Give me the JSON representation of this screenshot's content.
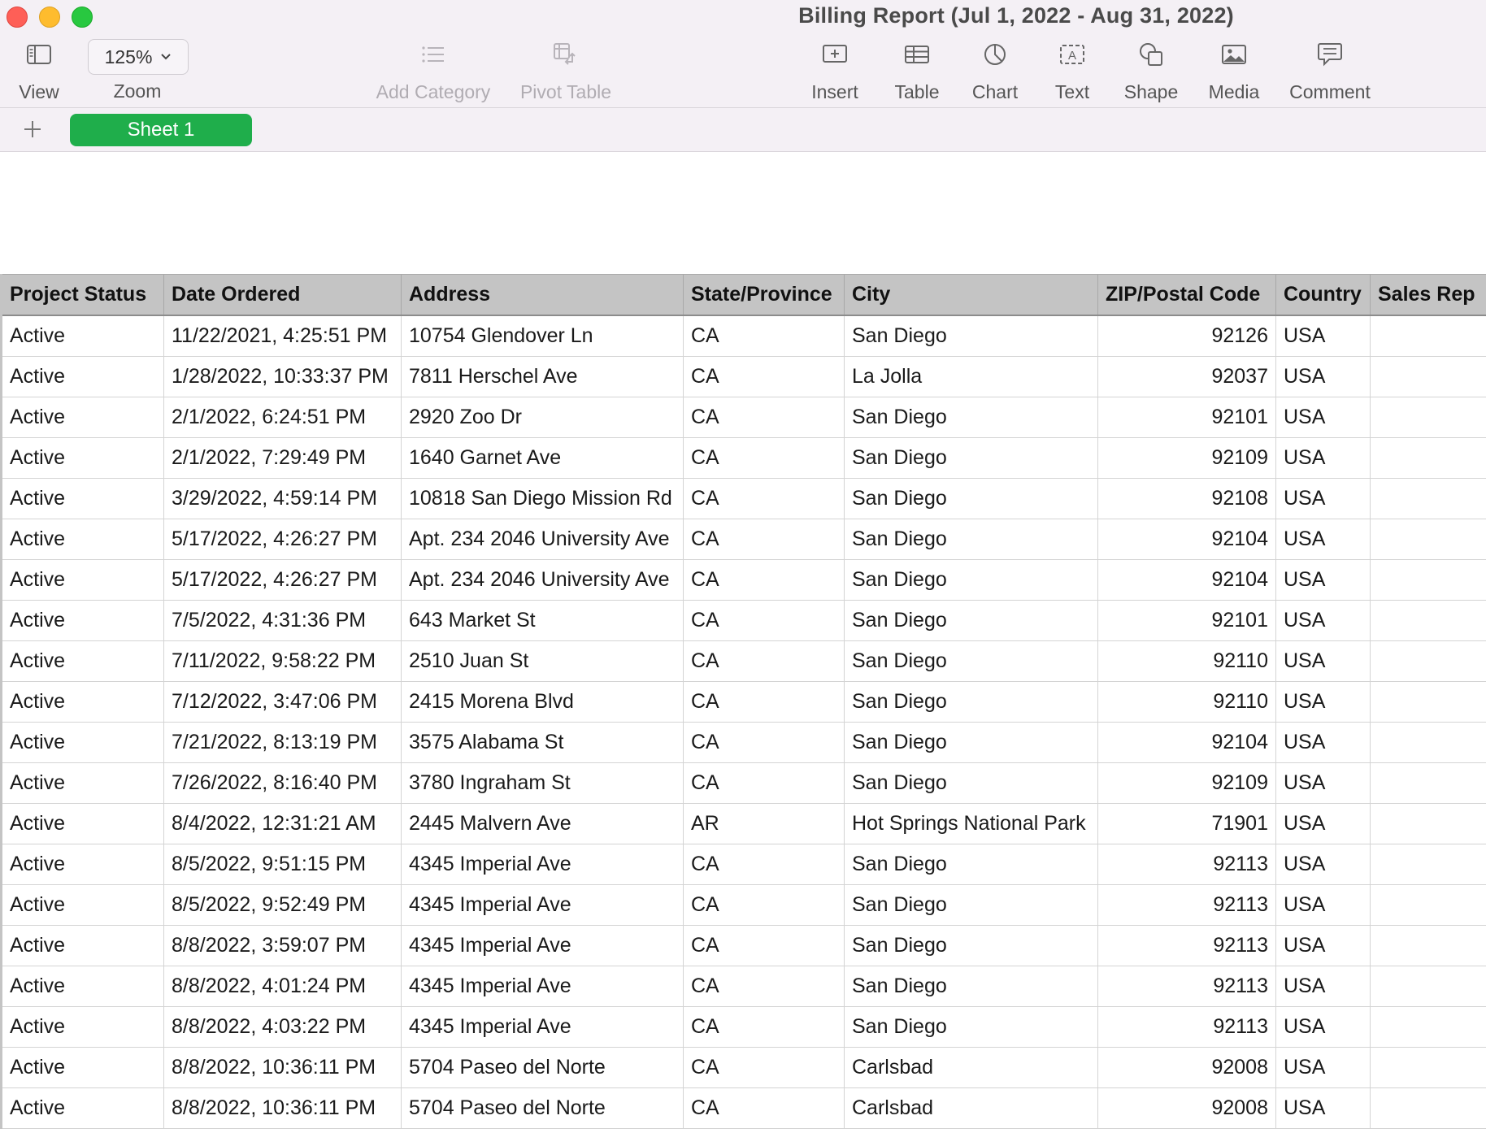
{
  "window": {
    "title": "Billing Report (Jul 1, 2022 - Aug 31, 2022)"
  },
  "toolbar": {
    "view_label": "View",
    "zoom_value": "125%",
    "zoom_label": "Zoom",
    "add_category_label": "Add Category",
    "pivot_table_label": "Pivot Table",
    "insert_label": "Insert",
    "table_label": "Table",
    "chart_label": "Chart",
    "text_label": "Text",
    "shape_label": "Shape",
    "media_label": "Media",
    "comment_label": "Comment"
  },
  "sheets": {
    "active_tab": "Sheet 1"
  },
  "colors": {
    "sheet_tab": "#1fae4b",
    "header_bg": "#c4c4c4",
    "toolbar_bg": "#f4f0f5"
  },
  "table": {
    "headers": [
      "Project Status",
      "Date Ordered",
      "Address",
      "State/Province",
      "City",
      "ZIP/Postal Code",
      "Country",
      "Sales Rep"
    ],
    "rows": [
      [
        "Active",
        "11/22/2021, 4:25:51 PM",
        "10754 Glendover Ln",
        "CA",
        "San Diego",
        "92126",
        "USA",
        ""
      ],
      [
        "Active",
        "1/28/2022, 10:33:37 PM",
        "7811 Herschel Ave",
        "CA",
        "La Jolla",
        "92037",
        "USA",
        ""
      ],
      [
        "Active",
        "2/1/2022, 6:24:51 PM",
        "2920 Zoo Dr",
        "CA",
        "San Diego",
        "92101",
        "USA",
        ""
      ],
      [
        "Active",
        "2/1/2022, 7:29:49 PM",
        "1640 Garnet Ave",
        "CA",
        "San Diego",
        "92109",
        "USA",
        ""
      ],
      [
        "Active",
        "3/29/2022, 4:59:14 PM",
        "10818 San Diego Mission Rd",
        "CA",
        "San Diego",
        "92108",
        "USA",
        ""
      ],
      [
        "Active",
        "5/17/2022, 4:26:27 PM",
        "Apt. 234 2046 University Ave",
        "CA",
        "San Diego",
        "92104",
        "USA",
        ""
      ],
      [
        "Active",
        "5/17/2022, 4:26:27 PM",
        "Apt. 234 2046 University Ave",
        "CA",
        "San Diego",
        "92104",
        "USA",
        ""
      ],
      [
        "Active",
        "7/5/2022, 4:31:36 PM",
        "643 Market St",
        "CA",
        "San Diego",
        "92101",
        "USA",
        ""
      ],
      [
        "Active",
        "7/11/2022, 9:58:22 PM",
        "2510 Juan St",
        "CA",
        "San Diego",
        "92110",
        "USA",
        ""
      ],
      [
        "Active",
        "7/12/2022, 3:47:06 PM",
        "2415 Morena Blvd",
        "CA",
        "San Diego",
        "92110",
        "USA",
        ""
      ],
      [
        "Active",
        "7/21/2022, 8:13:19 PM",
        "3575 Alabama St",
        "CA",
        "San Diego",
        "92104",
        "USA",
        ""
      ],
      [
        "Active",
        "7/26/2022, 8:16:40 PM",
        "3780 Ingraham St",
        "CA",
        "San Diego",
        "92109",
        "USA",
        ""
      ],
      [
        "Active",
        "8/4/2022, 12:31:21 AM",
        "2445 Malvern Ave",
        "AR",
        "Hot Springs National Park",
        "71901",
        "USA",
        ""
      ],
      [
        "Active",
        "8/5/2022, 9:51:15 PM",
        "4345 Imperial Ave",
        "CA",
        "San Diego",
        "92113",
        "USA",
        ""
      ],
      [
        "Active",
        "8/5/2022, 9:52:49 PM",
        "4345 Imperial Ave",
        "CA",
        "San Diego",
        "92113",
        "USA",
        ""
      ],
      [
        "Active",
        "8/8/2022, 3:59:07 PM",
        "4345 Imperial Ave",
        "CA",
        "San Diego",
        "92113",
        "USA",
        ""
      ],
      [
        "Active",
        "8/8/2022, 4:01:24 PM",
        "4345 Imperial Ave",
        "CA",
        "San Diego",
        "92113",
        "USA",
        ""
      ],
      [
        "Active",
        "8/8/2022, 4:03:22 PM",
        "4345 Imperial Ave",
        "CA",
        "San Diego",
        "92113",
        "USA",
        ""
      ],
      [
        "Active",
        "8/8/2022, 10:36:11 PM",
        "5704 Paseo del Norte",
        "CA",
        "Carlsbad",
        "92008",
        "USA",
        ""
      ],
      [
        "Active",
        "8/8/2022, 10:36:11 PM",
        "5704 Paseo del Norte",
        "CA",
        "Carlsbad",
        "92008",
        "USA",
        ""
      ]
    ]
  }
}
